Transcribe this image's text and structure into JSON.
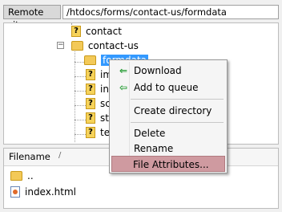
{
  "remote_site": {
    "label": "Remote site:",
    "path": "/htdocs/forms/contact-us/formdata"
  },
  "tree": {
    "items": [
      {
        "label": "contact",
        "icon": "question-icon"
      },
      {
        "label": "contact-us",
        "icon": "folder-icon",
        "expanded": true
      },
      {
        "label": "formdata",
        "icon": "folder-icon",
        "selected": true
      },
      {
        "label": "im",
        "icon": "question-icon"
      },
      {
        "label": "inc",
        "icon": "question-icon"
      },
      {
        "label": "sc",
        "icon": "question-icon"
      },
      {
        "label": "sty",
        "icon": "question-icon"
      },
      {
        "label": "ter",
        "icon": "question-icon"
      }
    ],
    "expander_collapsed": "+",
    "expander_expanded": "−"
  },
  "file_list": {
    "header": "Filename",
    "sort_indicator": "/",
    "rows": [
      {
        "name": "..",
        "icon": "folder-icon"
      },
      {
        "name": "index.html",
        "icon": "html-file-icon"
      }
    ]
  },
  "context_menu": {
    "items": [
      {
        "label": "Download",
        "icon": "download-arrow-icon",
        "icon_glyph": "⇐"
      },
      {
        "label": "Add to queue",
        "icon": "add-to-queue-icon",
        "icon_glyph": "⇦"
      },
      {
        "label": "Create directory"
      },
      {
        "label": "Delete"
      },
      {
        "label": "Rename"
      },
      {
        "label": "File Attributes...",
        "highlighted": true
      }
    ]
  },
  "colors": {
    "selection": "#3399ff",
    "highlight": "#cf9aa0",
    "arrow": "#1f9a2e"
  }
}
